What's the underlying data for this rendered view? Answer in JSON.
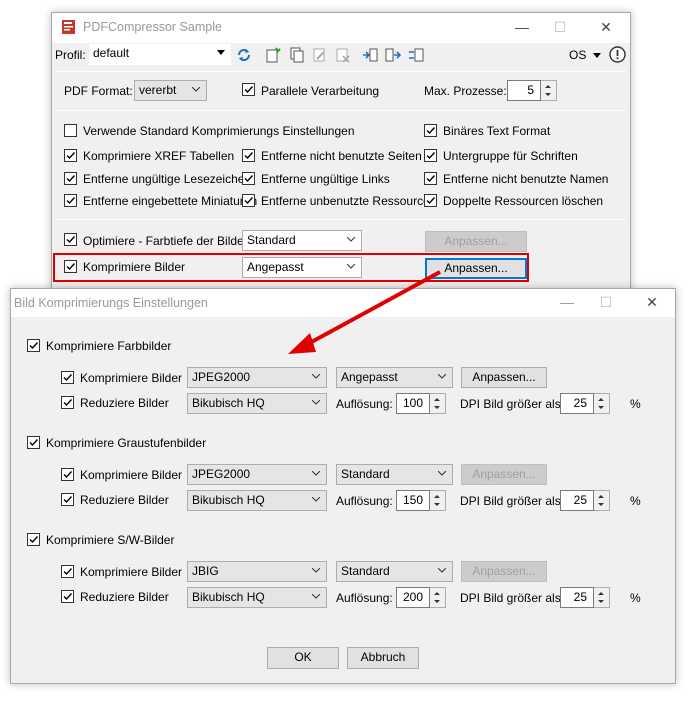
{
  "main": {
    "title": "PDFCompressor Sample",
    "profil_label": "Profil:",
    "profil_value": "default",
    "os_label": "OS",
    "pdf_format_label": "PDF Format:",
    "pdf_format_value": "vererbt",
    "parallel_label": "Parallele Verarbeitung",
    "max_proc_label": "Max. Prozesse:",
    "max_proc_value": "5",
    "opts": {
      "standard": "Verwende Standard Komprimierungs Einstellungen",
      "binary": "Binäres Text Format",
      "xref": "Komprimiere XREF Tabellen",
      "unused_pages": "Entferne nicht benutzte Seiten",
      "font_subset": "Untergruppe für Schriften",
      "invalid_bookmarks": "Entferne ungültige Lesezeichen",
      "invalid_links": "Entferne ungültige Links",
      "unused_names": "Entferne nicht benutzte Namen",
      "embedded_thumbs": "Entferne eingebettete Miniaturen",
      "unused_resources": "Entferne unbenutzte Ressourcen",
      "dup_resources": "Doppelte Ressourcen löschen"
    },
    "color_depth_label": "Optimiere - Farbtiefe der Bilder",
    "color_depth_value": "Standard",
    "compress_images_label": "Komprimiere Bilder",
    "compress_images_value": "Angepasst",
    "customize": "Anpassen..."
  },
  "dialog": {
    "title": "Bild Komprimierungs Einstellungen",
    "resolution_label": "Auflösung:",
    "dpi_label": "DPI Bild größer als:",
    "percent": "%",
    "compress_label": "Komprimiere Bilder",
    "reduce_label": "Reduziere Bilder",
    "customize": "Anpassen...",
    "ok": "OK",
    "cancel": "Abbruch",
    "groups": [
      {
        "title": "Komprimiere Farbbilder",
        "method": "JPEG2000",
        "quality": "Angepasst",
        "downsample": "Bikubisch HQ",
        "resolution": "100",
        "threshold": "25",
        "customize_enabled": true
      },
      {
        "title": "Komprimiere Graustufenbilder",
        "method": "JPEG2000",
        "quality": "Standard",
        "downsample": "Bikubisch HQ",
        "resolution": "150",
        "threshold": "25",
        "customize_enabled": false
      },
      {
        "title": "Komprimiere S/W-Bilder",
        "method": "JBIG",
        "quality": "Standard",
        "downsample": "Bikubisch HQ",
        "resolution": "200",
        "threshold": "25",
        "customize_enabled": false
      }
    ]
  },
  "colors": {
    "highlight": "#e00000",
    "arrow": "#e00000",
    "focus": "#0078d7"
  }
}
